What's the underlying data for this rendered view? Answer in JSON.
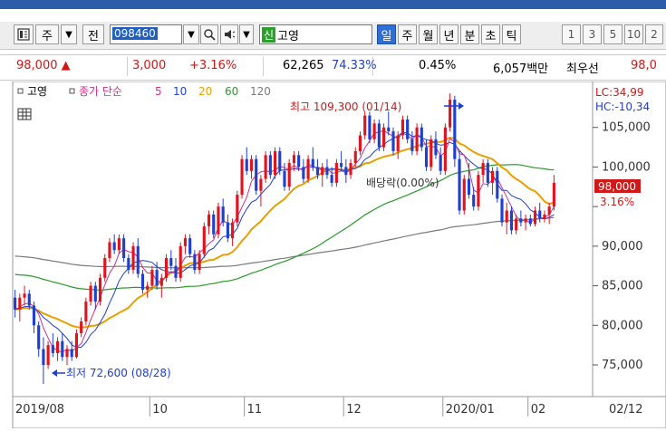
{
  "toolbar": {
    "menu_icon": "chart-menu-icon",
    "label_ju": "주",
    "label_jeon": "전",
    "stock_code": "098460",
    "stock_name": "고영",
    "shin_badge": "신",
    "periods": [
      "일",
      "주",
      "월",
      "년",
      "분",
      "초",
      "틱"
    ],
    "active_period": "일",
    "intervals": [
      "1",
      "3",
      "5",
      "10",
      "2"
    ]
  },
  "quote": {
    "price": "98,000",
    "up_arrow": "▲",
    "change": "3,000",
    "change_pct": "+3.16%",
    "volume": "62,265",
    "ratio1": "74.33%",
    "ratio2": "0.45%",
    "amount": "6,057백만",
    "best_ask_label": "최우선",
    "best_ask": "98,0"
  },
  "legend": {
    "name": "고영",
    "ma_label": "종가 단순",
    "ma_periods": [
      "5",
      "10",
      "20",
      "60",
      "120"
    ],
    "ma_colors": [
      "#d0308a",
      "#1f3fd0",
      "#e8a000",
      "#2a9a2a",
      "#7a7a7a"
    ]
  },
  "annotations": {
    "high": "최고 109,300 (01/14)",
    "low": "최저 72,600 (08/28)",
    "dividend": "배당락(0.00%)",
    "lc": "LC:34,99",
    "hc": "HC:-10,34",
    "current_price": "98,000",
    "current_pct": "3.16%"
  },
  "chart_data": {
    "type": "candlestick",
    "y_ticks": [
      75000,
      80000,
      85000,
      90000,
      95000,
      100000,
      105000
    ],
    "y_tick_labels": [
      "75,000",
      "80,000",
      "85,000",
      "90,000",
      "",
      "100,000",
      "105,000"
    ],
    "ylim": [
      71000,
      110800
    ],
    "x_labels": [
      "2019/08",
      "10",
      "11",
      "12",
      "2020/01",
      "02"
    ],
    "x_label_index": [
      0,
      29,
      49,
      70,
      91,
      109
    ],
    "right_date": "02/12",
    "ohlc": [
      [
        83500,
        84500,
        81000,
        82000
      ],
      [
        82000,
        84000,
        80500,
        83500
      ],
      [
        83500,
        85000,
        82500,
        84000
      ],
      [
        84000,
        84500,
        82000,
        82500
      ],
      [
        82500,
        83000,
        79000,
        80000
      ],
      [
        80000,
        80500,
        76000,
        77000
      ],
      [
        77000,
        78500,
        72600,
        75000
      ],
      [
        75000,
        78000,
        74500,
        77500
      ],
      [
        77500,
        79000,
        76000,
        76500
      ],
      [
        76500,
        78500,
        75500,
        78000
      ],
      [
        78000,
        79000,
        75500,
        76000
      ],
      [
        76000,
        77500,
        75000,
        77000
      ],
      [
        77000,
        78000,
        75500,
        76000
      ],
      [
        76000,
        79500,
        75800,
        79000
      ],
      [
        79000,
        81000,
        78500,
        80500
      ],
      [
        80500,
        83500,
        80000,
        83000
      ],
      [
        83000,
        85500,
        82500,
        85000
      ],
      [
        85000,
        85500,
        82000,
        83000
      ],
      [
        83000,
        86500,
        82500,
        86000
      ],
      [
        86000,
        89000,
        85500,
        88500
      ],
      [
        88500,
        91000,
        88000,
        90500
      ],
      [
        90500,
        91500,
        89000,
        89500
      ],
      [
        89500,
        91500,
        89000,
        91000
      ],
      [
        91000,
        91500,
        88000,
        88500
      ],
      [
        88500,
        89000,
        86500,
        87000
      ],
      [
        87000,
        90500,
        86500,
        90000
      ],
      [
        90000,
        91000,
        86000,
        86500
      ],
      [
        86500,
        87000,
        84000,
        84500
      ],
      [
        84500,
        85500,
        83500,
        85000
      ],
      [
        85000,
        87500,
        84500,
        87000
      ],
      [
        87000,
        88000,
        84500,
        85000
      ],
      [
        85000,
        86500,
        83500,
        86000
      ],
      [
        86000,
        89000,
        85500,
        88500
      ],
      [
        88500,
        89500,
        87000,
        87500
      ],
      [
        87500,
        88500,
        85500,
        86000
      ],
      [
        86000,
        90500,
        85500,
        90000
      ],
      [
        90000,
        91500,
        89000,
        91000
      ],
      [
        91000,
        91500,
        88500,
        89000
      ],
      [
        89000,
        89500,
        86500,
        87000
      ],
      [
        87000,
        89500,
        86500,
        89000
      ],
      [
        89000,
        93000,
        88500,
        92500
      ],
      [
        92500,
        94500,
        91500,
        94000
      ],
      [
        94000,
        94500,
        91000,
        91500
      ],
      [
        91500,
        95500,
        91000,
        95000
      ],
      [
        95000,
        96000,
        92500,
        93000
      ],
      [
        93000,
        94000,
        90500,
        91000
      ],
      [
        91000,
        93500,
        90000,
        93000
      ],
      [
        93000,
        97000,
        92500,
        96500
      ],
      [
        96500,
        101500,
        96000,
        101000
      ],
      [
        101000,
        102500,
        99000,
        99500
      ],
      [
        99500,
        101500,
        98500,
        101000
      ],
      [
        101000,
        101500,
        96500,
        97000
      ],
      [
        97000,
        99000,
        95000,
        98500
      ],
      [
        98500,
        102000,
        98000,
        101500
      ],
      [
        101500,
        102000,
        98500,
        99000
      ],
      [
        99000,
        102500,
        98500,
        102000
      ],
      [
        102000,
        102500,
        99000,
        99500
      ],
      [
        99500,
        100500,
        97000,
        97500
      ],
      [
        97500,
        101000,
        97000,
        100500
      ],
      [
        100500,
        102000,
        99500,
        101500
      ],
      [
        101500,
        102000,
        99500,
        100000
      ],
      [
        100000,
        101000,
        98000,
        98500
      ],
      [
        98500,
        101500,
        98000,
        101000
      ],
      [
        101000,
        102500,
        99500,
        100000
      ],
      [
        100000,
        101000,
        98500,
        99000
      ],
      [
        99000,
        100500,
        97500,
        100000
      ],
      [
        100000,
        101000,
        98500,
        99000
      ],
      [
        99000,
        100000,
        97500,
        98000
      ],
      [
        98000,
        101000,
        97500,
        100500
      ],
      [
        100500,
        102000,
        99500,
        100000
      ],
      [
        100000,
        101000,
        98000,
        99000
      ],
      [
        99000,
        101000,
        98500,
        100500
      ],
      [
        100500,
        102500,
        100000,
        102000
      ],
      [
        102000,
        104500,
        101500,
        104000
      ],
      [
        104000,
        107000,
        103500,
        106500
      ],
      [
        106500,
        107000,
        103000,
        103500
      ],
      [
        103500,
        106000,
        103000,
        105500
      ],
      [
        105500,
        106000,
        102000,
        102500
      ],
      [
        102500,
        105500,
        102000,
        105000
      ],
      [
        105000,
        107000,
        104000,
        104500
      ],
      [
        104500,
        105000,
        101500,
        102000
      ],
      [
        102000,
        104500,
        101000,
        104000
      ],
      [
        104000,
        106500,
        103500,
        106000
      ],
      [
        106000,
        106500,
        103000,
        103500
      ],
      [
        103500,
        104500,
        101500,
        102000
      ],
      [
        102000,
        105500,
        101500,
        105000
      ],
      [
        105000,
        105500,
        102000,
        102500
      ],
      [
        102500,
        103500,
        99500,
        100000
      ],
      [
        100000,
        104000,
        99500,
        103500
      ],
      [
        103500,
        104500,
        101000,
        101500
      ],
      [
        101500,
        102500,
        99000,
        99500
      ],
      [
        99500,
        105500,
        99000,
        105000
      ],
      [
        105000,
        109300,
        104500,
        108500
      ],
      [
        108500,
        109000,
        100000,
        101000
      ],
      [
        101000,
        102000,
        94000,
        94500
      ],
      [
        94500,
        99000,
        94000,
        98500
      ],
      [
        98500,
        100500,
        96000,
        96500
      ],
      [
        96500,
        97500,
        94500,
        95000
      ],
      [
        95000,
        99500,
        94500,
        99000
      ],
      [
        99000,
        101000,
        98000,
        100500
      ],
      [
        100500,
        101000,
        97500,
        98000
      ],
      [
        98000,
        100000,
        96500,
        99500
      ],
      [
        99500,
        100000,
        95500,
        96000
      ],
      [
        96000,
        96500,
        92500,
        93000
      ],
      [
        93000,
        95500,
        91500,
        94500
      ],
      [
        94500,
        95000,
        91500,
        92000
      ],
      [
        92000,
        94000,
        91500,
        93500
      ],
      [
        93500,
        94500,
        92500,
        93000
      ],
      [
        93000,
        94000,
        92000,
        93500
      ],
      [
        93500,
        94000,
        92500,
        92800
      ],
      [
        92800,
        95000,
        92500,
        94500
      ],
      [
        94500,
        95500,
        93000,
        93500
      ],
      [
        93500,
        94500,
        93000,
        94000
      ],
      [
        94000,
        95500,
        92800,
        95000
      ],
      [
        95000,
        99000,
        94500,
        98000
      ]
    ],
    "ma_start": {
      "ma20": 82000,
      "ma60": 86500,
      "ma120": 88800
    }
  }
}
